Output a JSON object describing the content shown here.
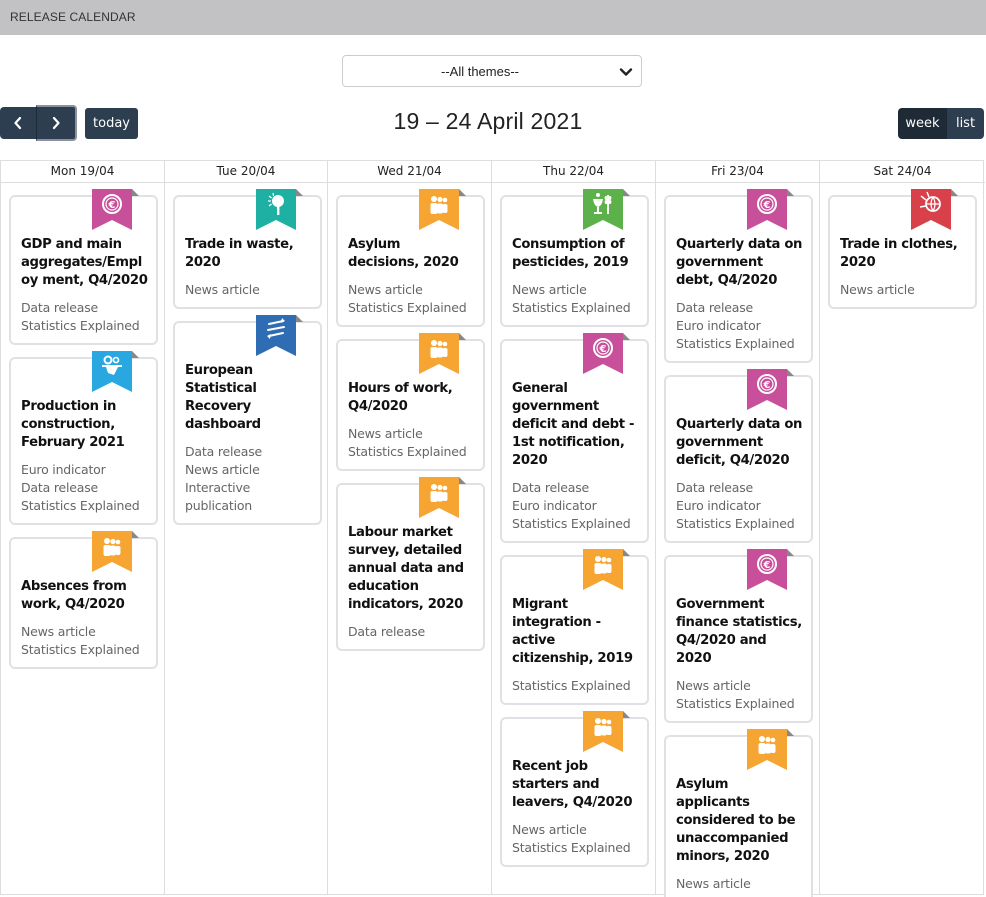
{
  "header": {
    "title": "RELEASE CALENDAR"
  },
  "filter": {
    "selected": "--All themes--"
  },
  "toolbar": {
    "prev_icon": "chevron-left-icon",
    "next_icon": "chevron-right-icon",
    "today_label": "today",
    "range_title": "19 – 24 April 2021",
    "views": [
      {
        "label": "week",
        "active": true
      },
      {
        "label": "list",
        "active": false
      }
    ]
  },
  "theme_colors": {
    "economy": "#c8509a",
    "environment": "#1fb0a4",
    "cross-cutting": "#2e6db4",
    "industry": "#29a7e1",
    "population": "#f6a532",
    "agriculture": "#5db14b",
    "trade": "#d9414a"
  },
  "days": [
    {
      "label": "Mon 19/04",
      "events": [
        {
          "title": "GDP and main aggregates/Employ ment, Q4/2020",
          "theme": "economy",
          "icon": "euro-icon",
          "types": [
            "Data release",
            "Statistics Explained"
          ]
        },
        {
          "title": "Production in construction, February 2021",
          "theme": "industry",
          "icon": "industry-gears-icon",
          "types": [
            "Euro indicator",
            "Data release",
            "Statistics Explained"
          ]
        },
        {
          "title": "Absences from work, Q4/2020",
          "theme": "population",
          "icon": "people-icon",
          "types": [
            "News article",
            "Statistics Explained"
          ]
        }
      ]
    },
    {
      "label": "Tue 20/04",
      "events": [
        {
          "title": "Trade in waste, 2020",
          "theme": "environment",
          "icon": "tree-sun-icon",
          "types": [
            "News article"
          ]
        },
        {
          "title": "European Statistical Recovery dashboard",
          "theme": "cross-cutting",
          "icon": "arrows-exchange-icon",
          "types": [
            "Data release",
            "News article",
            "Interactive publication"
          ]
        }
      ]
    },
    {
      "label": "Wed 21/04",
      "events": [
        {
          "title": "Asylum decisions, 2020",
          "theme": "population",
          "icon": "people-icon",
          "types": [
            "News article",
            "Statistics Explained"
          ]
        },
        {
          "title": "Hours of work, Q4/2020",
          "theme": "population",
          "icon": "people-icon",
          "types": [
            "News article",
            "Statistics Explained"
          ]
        },
        {
          "title": "Labour market survey, detailed annual data and education indicators, 2020",
          "theme": "population",
          "icon": "people-icon",
          "types": [
            "Data release"
          ]
        }
      ]
    },
    {
      "label": "Thu 22/04",
      "events": [
        {
          "title": "Consumption of pesticides, 2019",
          "theme": "agriculture",
          "icon": "agriculture-food-icon",
          "types": [
            "News article",
            "Statistics Explained"
          ]
        },
        {
          "title": "General government deficit and debt - 1st notification, 2020",
          "theme": "economy",
          "icon": "euro-icon",
          "types": [
            "Data release",
            "Euro indicator",
            "Statistics Explained"
          ]
        },
        {
          "title": "Migrant integration - active citizenship, 2019",
          "theme": "population",
          "icon": "people-icon",
          "types": [
            "Statistics Explained"
          ]
        },
        {
          "title": "Recent job starters and leavers, Q4/2020",
          "theme": "population",
          "icon": "people-icon",
          "types": [
            "News article",
            "Statistics Explained"
          ]
        }
      ]
    },
    {
      "label": "Fri 23/04",
      "events": [
        {
          "title": "Quarterly data on government debt, Q4/2020",
          "theme": "economy",
          "icon": "euro-icon",
          "types": [
            "Data release",
            "Euro indicator",
            "Statistics Explained"
          ]
        },
        {
          "title": "Quarterly data on government deficit, Q4/2020",
          "theme": "economy",
          "icon": "euro-icon",
          "types": [
            "Data release",
            "Euro indicator",
            "Statistics Explained"
          ]
        },
        {
          "title": "Government finance statistics, Q4/2020 and 2020",
          "theme": "economy",
          "icon": "euro-icon",
          "types": [
            "News article",
            "Statistics Explained"
          ]
        },
        {
          "title": "Asylum applicants considered to be unaccompanied minors, 2020",
          "theme": "population",
          "icon": "people-icon",
          "types": [
            "News article"
          ]
        }
      ]
    },
    {
      "label": "Sat 24/04",
      "events": [
        {
          "title": "Trade in clothes, 2020",
          "theme": "trade",
          "icon": "globe-trade-icon",
          "types": [
            "News article"
          ]
        }
      ]
    }
  ]
}
